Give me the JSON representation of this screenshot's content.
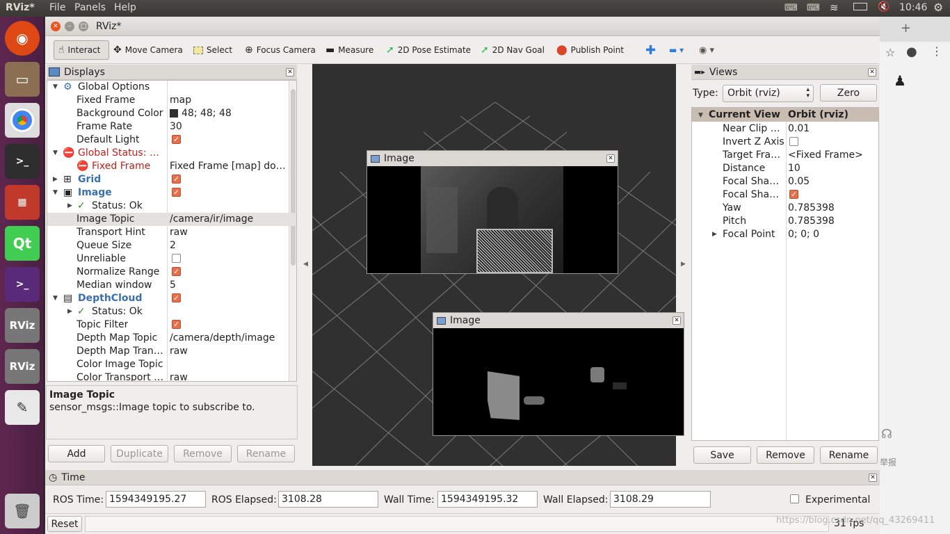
{
  "topbar": {
    "app": "RViz*",
    "menus": [
      "File",
      "Panels",
      "Help"
    ],
    "clock": "10:46"
  },
  "window": {
    "title": "RViz*"
  },
  "toolbar": {
    "interact": "Interact",
    "move_camera": "Move Camera",
    "select": "Select",
    "focus_camera": "Focus Camera",
    "measure": "Measure",
    "pose_estimate": "2D Pose Estimate",
    "nav_goal": "2D Nav Goal",
    "publish_point": "Publish Point"
  },
  "displays": {
    "title": "Displays",
    "rows": [
      {
        "label": "Global Options",
        "value": ""
      },
      {
        "label": "Fixed Frame",
        "value": "map"
      },
      {
        "label": "Background Color",
        "value": "48; 48; 48"
      },
      {
        "label": "Frame Rate",
        "value": "30"
      },
      {
        "label": "Default Light",
        "value": ""
      },
      {
        "label": "Global Status: E…",
        "value": ""
      },
      {
        "label": "Fixed Frame",
        "value": "Fixed Frame [map] do…"
      },
      {
        "label": "Grid",
        "value": ""
      },
      {
        "label": "Image",
        "value": ""
      },
      {
        "label": "Status: Ok",
        "value": ""
      },
      {
        "label": "Image Topic",
        "value": "/camera/ir/image"
      },
      {
        "label": "Transport Hint",
        "value": "raw"
      },
      {
        "label": "Queue Size",
        "value": "2"
      },
      {
        "label": "Unreliable",
        "value": ""
      },
      {
        "label": "Normalize Range",
        "value": ""
      },
      {
        "label": "Median window",
        "value": "5"
      },
      {
        "label": "DepthCloud",
        "value": ""
      },
      {
        "label": "Status: Ok",
        "value": ""
      },
      {
        "label": "Topic Filter",
        "value": ""
      },
      {
        "label": "Depth Map Topic",
        "value": "/camera/depth/image"
      },
      {
        "label": "Depth Map Tran…",
        "value": "raw"
      },
      {
        "label": "Color Image Topic",
        "value": ""
      },
      {
        "label": "Color Transport …",
        "value": "raw"
      }
    ],
    "desc_title": "Image Topic",
    "desc_text": "sensor_msgs::Image topic to subscribe to.",
    "buttons": {
      "add": "Add",
      "duplicate": "Duplicate",
      "remove": "Remove",
      "rename": "Rename"
    }
  },
  "image_windows": {
    "top": "Image",
    "bottom": "Image"
  },
  "views": {
    "title": "Views",
    "type_label": "Type:",
    "type_value": "Orbit (rviz)",
    "zero": "Zero",
    "header_left": "Current View",
    "header_right": "Orbit (rviz)",
    "rows": [
      {
        "label": "Near Clip …",
        "value": "0.01"
      },
      {
        "label": "Invert Z Axis",
        "value": ""
      },
      {
        "label": "Target Fra…",
        "value": "<Fixed Frame>"
      },
      {
        "label": "Distance",
        "value": "10"
      },
      {
        "label": "Focal Shap…",
        "value": "0.05"
      },
      {
        "label": "Focal Shap…",
        "value": ""
      },
      {
        "label": "Yaw",
        "value": "0.785398"
      },
      {
        "label": "Pitch",
        "value": "0.785398"
      },
      {
        "label": "Focal Point",
        "value": "0; 0; 0"
      }
    ],
    "buttons": {
      "save": "Save",
      "remove": "Remove",
      "rename": "Rename"
    }
  },
  "time": {
    "title": "Time",
    "ros_time_label": "ROS Time:",
    "ros_time": "1594349195.27",
    "ros_elapsed_label": "ROS Elapsed:",
    "ros_elapsed": "3108.28",
    "wall_time_label": "Wall Time:",
    "wall_time": "1594349195.32",
    "wall_elapsed_label": "Wall Elapsed:",
    "wall_elapsed": "3108.29",
    "experimental": "Experimental",
    "reset": "Reset",
    "fps": "31 fps"
  },
  "watermark": "https://blog.csdn.net/qq_43269411"
}
